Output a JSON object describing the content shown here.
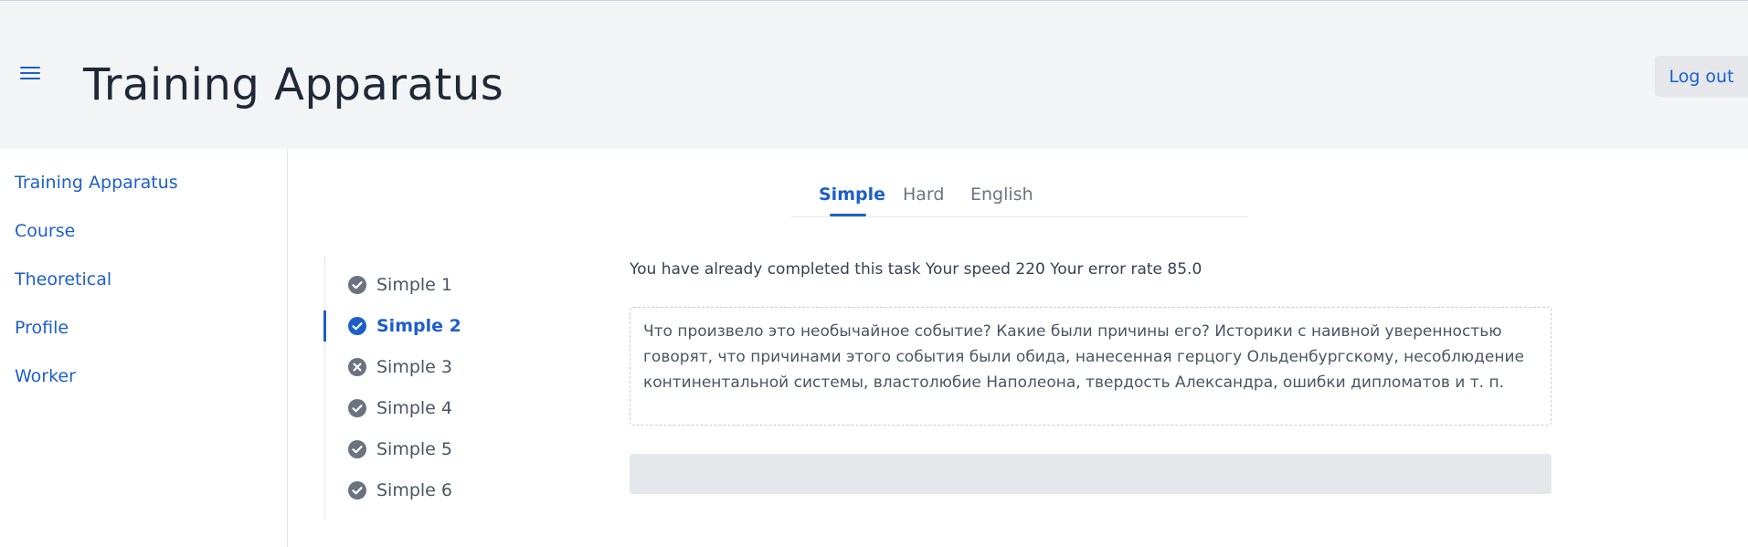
{
  "header": {
    "title": "Training Apparatus",
    "logout_label": "Log out"
  },
  "sidebar": {
    "items": [
      {
        "label": "Training Apparatus"
      },
      {
        "label": "Course"
      },
      {
        "label": "Theoretical"
      },
      {
        "label": "Profile"
      },
      {
        "label": "Worker"
      }
    ]
  },
  "tabs": [
    {
      "label": "Simple",
      "active": true
    },
    {
      "label": "Hard",
      "active": false
    },
    {
      "label": "English",
      "active": false
    }
  ],
  "tasks": [
    {
      "label": "Simple 1",
      "status": "completed",
      "icon": "check-circle-icon"
    },
    {
      "label": "Simple 2",
      "status": "active",
      "icon": "check-circle-icon"
    },
    {
      "label": "Simple 3",
      "status": "failed",
      "icon": "x-circle-icon"
    },
    {
      "label": "Simple 4",
      "status": "completed",
      "icon": "check-circle-icon"
    },
    {
      "label": "Simple 5",
      "status": "completed",
      "icon": "check-circle-icon"
    },
    {
      "label": "Simple 6",
      "status": "completed",
      "icon": "check-circle-icon"
    }
  ],
  "exercise": {
    "status_text": "You have already completed this task Your speed 220 Your error rate 85.0",
    "text": "Что произвело это необычайное событие? Какие были причины его? Историки с наивной уверенностью говорят, что причинами этого события были обида, нанесенная герцогу Ольденбургскому, несоблюдение континентальной системы, властолюбие Наполеона, твердость Александра, ошибки дипломатов и т. п.",
    "input_value": ""
  },
  "colors": {
    "accent": "#1d5fc9",
    "header_bg": "#f3f4f6",
    "muted_icon": "#6b7280"
  }
}
